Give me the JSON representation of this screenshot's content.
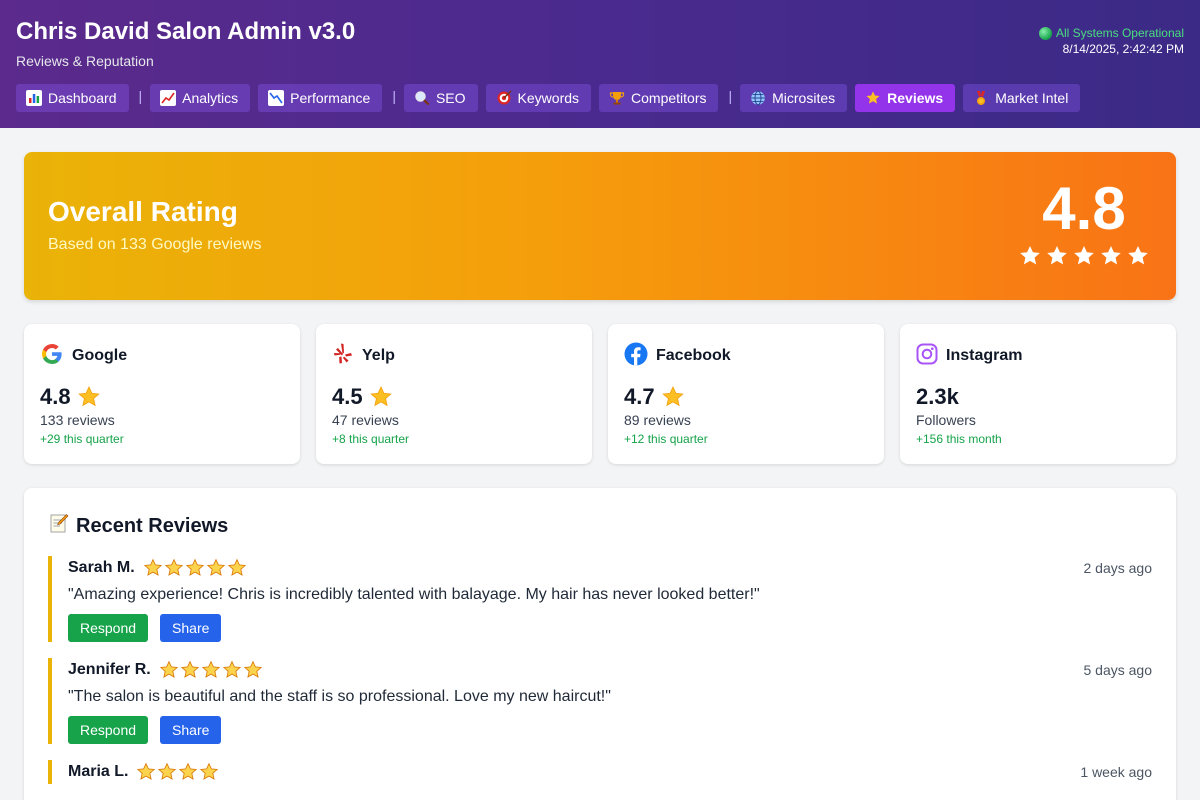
{
  "header": {
    "title": "Chris David Salon Admin v3.0",
    "subtitle": "Reviews & Reputation",
    "status": "All Systems Operational",
    "timestamp": "8/14/2025, 2:42:42 PM"
  },
  "nav": {
    "items": [
      {
        "label": "Dashboard",
        "icon": "bar-chart-icon"
      },
      {
        "label": "Analytics",
        "icon": "trend-up-icon"
      },
      {
        "label": "Performance",
        "icon": "trend-down-icon"
      },
      {
        "label": "SEO",
        "icon": "magnifier-icon"
      },
      {
        "label": "Keywords",
        "icon": "target-icon"
      },
      {
        "label": "Competitors",
        "icon": "trophy-icon"
      },
      {
        "label": "Microsites",
        "icon": "globe-icon"
      },
      {
        "label": "Reviews",
        "icon": "star-icon",
        "active": true
      },
      {
        "label": "Market Intel",
        "icon": "medal-icon"
      }
    ]
  },
  "overall": {
    "title": "Overall Rating",
    "subtitle": "Based on 133 Google reviews",
    "score": "4.8",
    "stars": 5
  },
  "platforms": [
    {
      "name": "Google",
      "icon": "google-icon",
      "score": "4.8",
      "count": "133 reviews",
      "delta": "+29 this quarter"
    },
    {
      "name": "Yelp",
      "icon": "yelp-icon",
      "score": "4.5",
      "count": "47 reviews",
      "delta": "+8 this quarter"
    },
    {
      "name": "Facebook",
      "icon": "facebook-icon",
      "score": "4.7",
      "count": "89 reviews",
      "delta": "+12 this quarter"
    },
    {
      "name": "Instagram",
      "icon": "instagram-icon",
      "score": "2.3k",
      "count": "Followers",
      "delta": "+156 this month"
    }
  ],
  "recent": {
    "title": "Recent Reviews",
    "respond_label": "Respond",
    "share_label": "Share",
    "items": [
      {
        "name": "Sarah M.",
        "stars": 5,
        "time": "2 days ago",
        "text": "\"Amazing experience! Chris is incredibly talented with balayage. My hair has never looked better!\""
      },
      {
        "name": "Jennifer R.",
        "stars": 5,
        "time": "5 days ago",
        "text": "\"The salon is beautiful and the staff is so professional. Love my new haircut!\""
      },
      {
        "name": "Maria L.",
        "stars": 4,
        "time": "1 week ago",
        "text": ""
      }
    ]
  },
  "colors": {
    "accent": "#9333ea",
    "header_bg": "#4a2a8e",
    "rating_gradient_start": "#eab308",
    "rating_gradient_end": "#f97316",
    "respond": "#16a34a",
    "share": "#2563eb",
    "review_border": "#eab308"
  }
}
